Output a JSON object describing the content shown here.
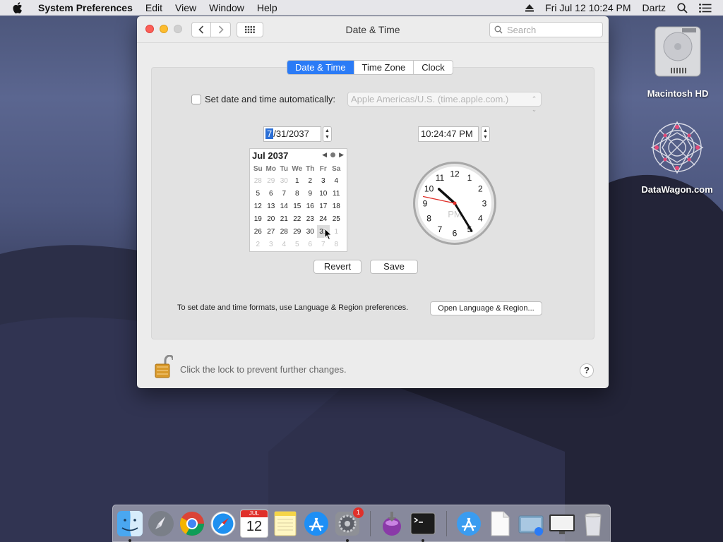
{
  "menubar": {
    "app_name": "System Preferences",
    "items": [
      "Edit",
      "View",
      "Window",
      "Help"
    ],
    "datetime": "Fri Jul 12  10:24 PM",
    "user": "Dartz"
  },
  "window": {
    "title": "Date & Time",
    "search_placeholder": "Search",
    "tabs": [
      {
        "label": "Date & Time",
        "active": true
      },
      {
        "label": "Time Zone",
        "active": false
      },
      {
        "label": "Clock",
        "active": false
      }
    ],
    "auto_label": "Set date and time automatically:",
    "auto_checked": false,
    "time_server": "Apple Americas/U.S. (time.apple.com.)",
    "date_month": "7",
    "date_rest": "/31/2037",
    "time_value": "10:24:47 PM",
    "calendar": {
      "header": "Jul 2037",
      "weekdays": [
        "Su",
        "Mo",
        "Tu",
        "We",
        "Th",
        "Fr",
        "Sa"
      ],
      "weeks": [
        [
          "28",
          "29",
          "30",
          "1",
          "2",
          "3",
          "4"
        ],
        [
          "5",
          "6",
          "7",
          "8",
          "9",
          "10",
          "11"
        ],
        [
          "12",
          "13",
          "14",
          "15",
          "16",
          "17",
          "18"
        ],
        [
          "19",
          "20",
          "21",
          "22",
          "23",
          "24",
          "25"
        ],
        [
          "26",
          "27",
          "28",
          "29",
          "30",
          "31",
          "1"
        ],
        [
          "2",
          "3",
          "4",
          "5",
          "6",
          "7",
          "8"
        ]
      ],
      "selected_day": "31"
    },
    "clock": {
      "numerals": [
        "12",
        "1",
        "2",
        "3",
        "4",
        "5",
        "6",
        "7",
        "8",
        "9",
        "10",
        "11"
      ],
      "meridiem": "PM",
      "hour": 10,
      "minute": 24,
      "second": 47
    },
    "revert_label": "Revert",
    "save_label": "Save",
    "format_note": "To set date and time formats, use Language & Region preferences.",
    "open_region_label": "Open Language & Region...",
    "lock_text": "Click the lock to prevent further changes.",
    "help_label": "?"
  },
  "desktop": {
    "icons": [
      {
        "label": "Macintosh HD"
      },
      {
        "label": "DataWagon.com"
      }
    ]
  },
  "dock": {
    "items": [
      "Finder",
      "Launchpad",
      "Chrome",
      "Safari",
      "Calendar",
      "Notes",
      "App Store",
      "System Preferences",
      "Installer",
      "Terminal",
      "App Store Folder",
      "Documents",
      "Preview",
      "Screen",
      "Trash"
    ],
    "calendar_month": "JUL",
    "calendar_day": "12",
    "badge": "1"
  },
  "colors": {
    "accent": "#2b7bf6",
    "close": "#fc5f57",
    "minimize": "#fdbc2e",
    "second_hand": "#e0302a"
  }
}
